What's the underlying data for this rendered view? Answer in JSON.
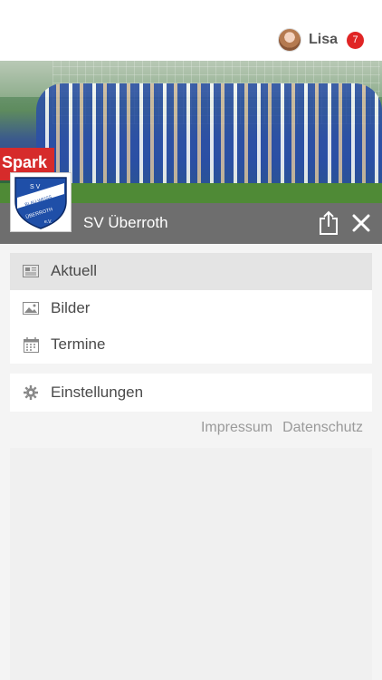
{
  "user": {
    "name": "Lisa",
    "notifications": "7"
  },
  "club": {
    "name": "SV Überroth",
    "logo_text": [
      "S V",
      "BLAU-WEISS",
      "ÜBERROTH",
      "e.V."
    ],
    "banner_text": "Spark"
  },
  "menu": {
    "items": [
      {
        "label": "Aktuell",
        "icon": "newspaper-icon",
        "active": true
      },
      {
        "label": "Bilder",
        "icon": "image-icon",
        "active": false
      },
      {
        "label": "Termine",
        "icon": "calendar-icon",
        "active": false
      }
    ],
    "settings": {
      "label": "Einstellungen",
      "icon": "gear-icon"
    }
  },
  "footer": {
    "impressum": "Impressum",
    "datenschutz": "Datenschutz"
  },
  "colors": {
    "accent_badge": "#e02525",
    "bar": "#6e6e6e",
    "club_blue": "#1f4fa8"
  }
}
